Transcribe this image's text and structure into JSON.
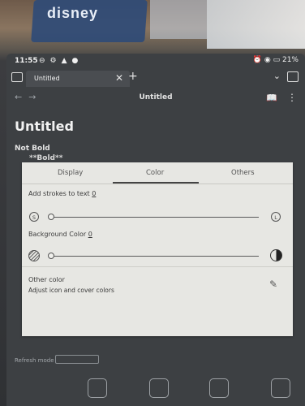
{
  "scene": {
    "logo_text": "disney"
  },
  "status_bar": {
    "time": "11:55",
    "battery": "21%"
  },
  "tab_bar": {
    "tab_title": "Untitled",
    "close": "✕",
    "add": "+"
  },
  "nav_bar": {
    "title": "Untitled"
  },
  "document": {
    "title": "Untitled",
    "line1": "Not Bold",
    "line2": "**Bold**"
  },
  "behind": {
    "refresh_label": "Refresh mode"
  },
  "dialog": {
    "tabs": [
      {
        "label": "Display",
        "active": false
      },
      {
        "label": "Color",
        "active": true
      },
      {
        "label": "Others",
        "active": false
      }
    ],
    "strokes": {
      "label": "Add strokes to text",
      "value": "0",
      "min_icon_text": "S",
      "max_icon_text": "L",
      "level": 0
    },
    "background": {
      "label": "Background Color",
      "value": "0",
      "level": 0
    },
    "other_color": {
      "title": "Other color",
      "subtitle": "Adjust icon and cover colors"
    }
  },
  "icons": {
    "sidebar": "sidebar-toggle-icon",
    "chevron": "chevron-down-icon",
    "split": "split-view-icon",
    "book": "book-icon",
    "kebab": "more-vertical-icon",
    "pencil": "pencil-icon",
    "hatch": "texture-icon",
    "contrast": "contrast-icon"
  }
}
